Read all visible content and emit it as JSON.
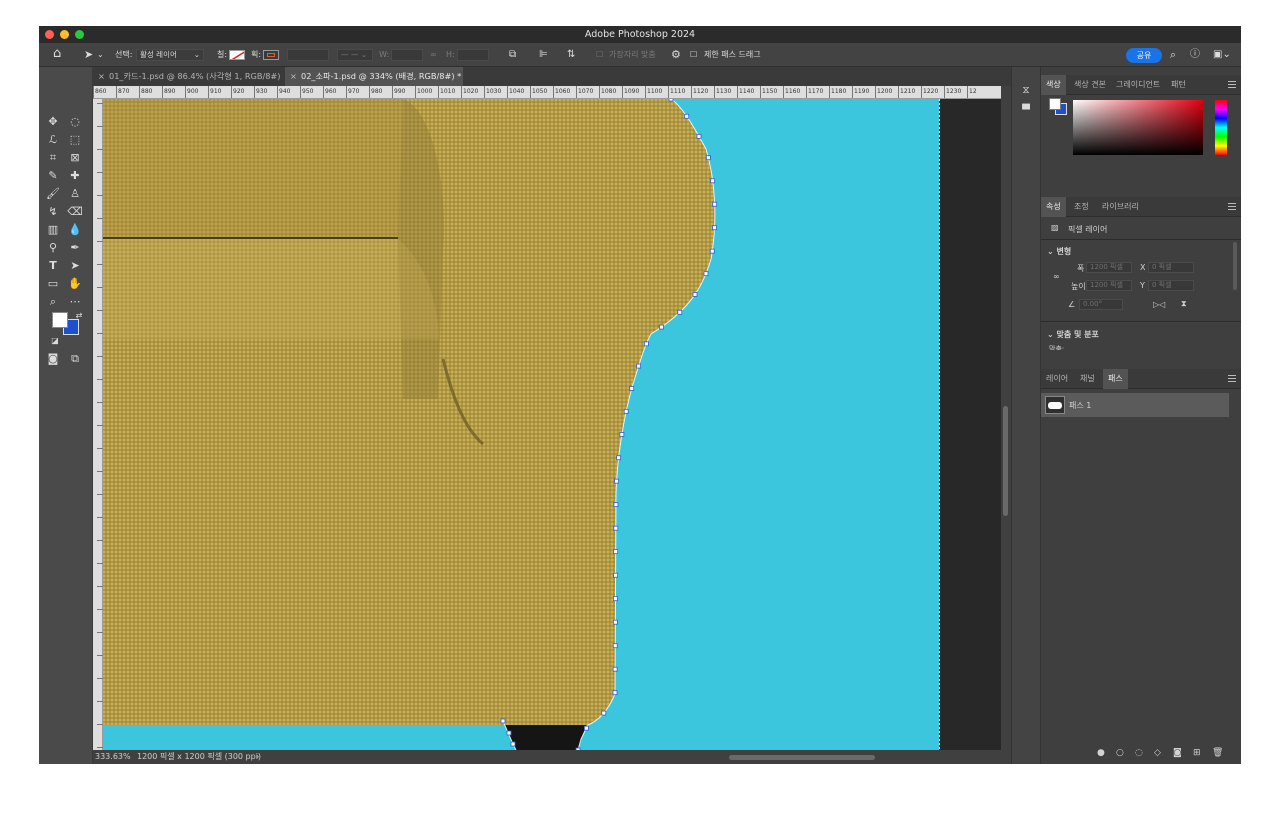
{
  "app": {
    "title": "Adobe Photoshop 2024"
  },
  "options_bar": {
    "select_label": "선택:",
    "select_value": "활성 레이어",
    "fill_label": "칠:",
    "stroke_label": "획:",
    "w_label": "W:",
    "h_label": "H:",
    "auto_align_label": "가장자리 맞춤",
    "constrain_label": "제한 패스 드래그",
    "share_label": "공유"
  },
  "tabs": [
    {
      "label": "01_카드-1.psd @ 86.4% (사각형 1, RGB/8#)"
    },
    {
      "label": "02_소파-1.psd @ 334% (배경, RGB/8#) *"
    }
  ],
  "ruler": {
    "ticks": [
      "860",
      "870",
      "880",
      "890",
      "900",
      "910",
      "920",
      "930",
      "940",
      "950",
      "960",
      "970",
      "980",
      "990",
      "1000",
      "1010",
      "1020",
      "1030",
      "1040",
      "1050",
      "1060",
      "1070",
      "1080",
      "1090",
      "1100",
      "1110",
      "1120",
      "1130",
      "1140",
      "1150",
      "1160",
      "1170",
      "1180",
      "1190",
      "1200",
      "1210",
      "1220",
      "1230",
      "12"
    ]
  },
  "status": {
    "zoom": "333.63%",
    "doc_info": "1200 픽셀 x 1200 픽셀 (300 ppi)"
  },
  "color_panel": {
    "tabs": [
      "색상",
      "색상 견본",
      "그레이디언트",
      "패턴"
    ],
    "foreground": "#ffffff",
    "background": "#1e4fd0"
  },
  "properties_panel": {
    "tabs": [
      "속성",
      "조정",
      "라이브러리"
    ],
    "layer_type": "픽셀 레이어",
    "transform_heading": "변형",
    "w_label": "폭",
    "w_value": "1200 픽셀",
    "x_label": "X",
    "x_value": "0 픽셀",
    "h_label": "높이",
    "h_value": "1200 픽셀",
    "y_label": "Y",
    "y_value": "0 픽셀",
    "angle_value": "0.00°",
    "align_heading": "맞춤 및 분포",
    "align_sub": "맞춤:"
  },
  "paths_panel": {
    "tabs": [
      "레이어",
      "채널",
      "패스"
    ],
    "items": [
      {
        "name": "패스 1"
      }
    ]
  },
  "colors": {
    "canvas_bg": "#3bc6dd",
    "sofa": "#b39a45",
    "pasteboard": "#282828"
  }
}
